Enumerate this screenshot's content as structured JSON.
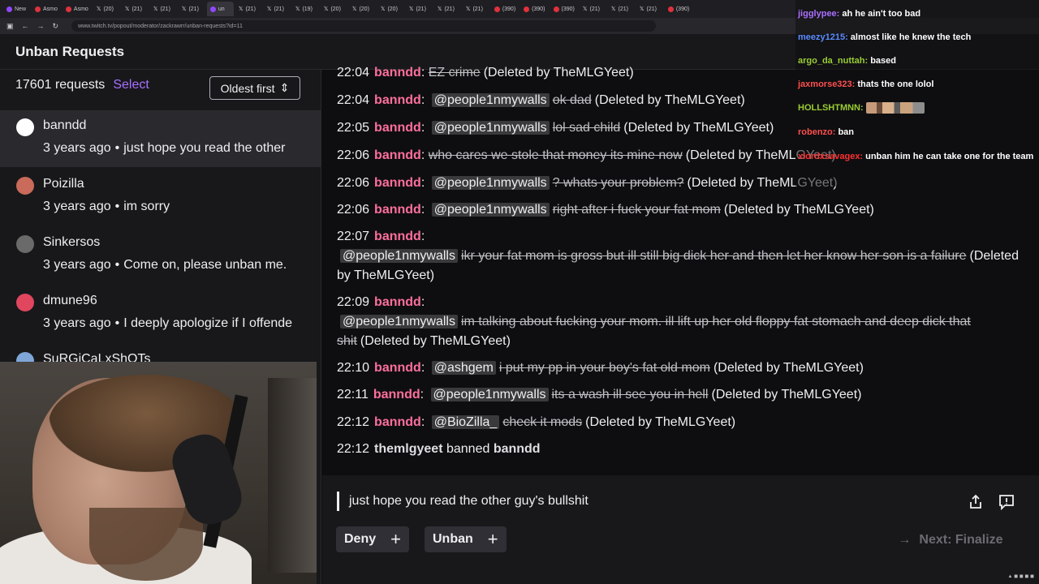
{
  "browser": {
    "tabs": [
      {
        "label": "New",
        "favicon": "twitch",
        "active": false
      },
      {
        "label": "Asmo",
        "favicon": "youtube",
        "active": false
      },
      {
        "label": "Asmo",
        "favicon": "youtube",
        "active": false
      },
      {
        "label": "(20)",
        "favicon": "x",
        "active": false
      },
      {
        "label": "(21)",
        "favicon": "x",
        "active": false
      },
      {
        "label": "(21)",
        "favicon": "x",
        "active": false
      },
      {
        "label": "(21)",
        "favicon": "x",
        "active": false
      },
      {
        "label": "un",
        "favicon": "twitch",
        "active": true
      },
      {
        "label": "(21)",
        "favicon": "x",
        "active": false
      },
      {
        "label": "(21)",
        "favicon": "x",
        "active": false
      },
      {
        "label": "(19)",
        "favicon": "x",
        "active": false
      },
      {
        "label": "(20)",
        "favicon": "x",
        "active": false
      },
      {
        "label": "(20)",
        "favicon": "x",
        "active": false
      },
      {
        "label": "(20)",
        "favicon": "x",
        "active": false
      },
      {
        "label": "(21)",
        "favicon": "x",
        "active": false
      },
      {
        "label": "(21)",
        "favicon": "x",
        "active": false
      },
      {
        "label": "(21)",
        "favicon": "x",
        "active": false
      },
      {
        "label": "(390)",
        "favicon": "youtube",
        "active": false
      },
      {
        "label": "(390)",
        "favicon": "youtube",
        "active": false
      },
      {
        "label": "(390)",
        "favicon": "youtube",
        "active": false
      },
      {
        "label": "(21)",
        "favicon": "x",
        "active": false
      },
      {
        "label": "(21)",
        "favicon": "x",
        "active": false
      },
      {
        "label": "(21)",
        "favicon": "x",
        "active": false
      },
      {
        "label": "(390)",
        "favicon": "youtube",
        "active": false
      }
    ],
    "url": "www.twitch.tv/popout/moderator/zackrawrr/unban-requests?id=11"
  },
  "page": {
    "title": "Unban Requests"
  },
  "list": {
    "count": "17601 requests",
    "select_label": "Select",
    "sort_label": "Oldest first",
    "items": [
      {
        "username": "banndd",
        "age": "3 years ago",
        "preview": "just hope you read the other",
        "avatar_color": "#ffffff",
        "selected": true
      },
      {
        "username": "Poizilla",
        "age": "3 years ago",
        "preview": "im sorry",
        "avatar_color": "#c96a5a",
        "selected": false
      },
      {
        "username": "Sinkersos",
        "age": "3 years ago",
        "preview": "Come on, please unban me.",
        "avatar_color": "#6a6a6a",
        "selected": false
      },
      {
        "username": "dmune96",
        "age": "3 years ago",
        "preview": "I deeply apologize if I offende",
        "avatar_color": "#e0465e",
        "selected": false
      },
      {
        "username": "SuRGiCaLxShOTs",
        "age": "",
        "preview": "",
        "avatar_color": "#7fa6d9",
        "selected": false
      }
    ]
  },
  "log": {
    "lines": [
      {
        "time": "22:04",
        "user": "banndd",
        "mention": "",
        "text": "EZ crime",
        "note": "(Deleted by TheMLGYeet)"
      },
      {
        "time": "22:04",
        "user": "banndd",
        "mention": "@people1nmywalls",
        "text": "ok dad",
        "note": "(Deleted by TheMLGYeet)"
      },
      {
        "time": "22:05",
        "user": "banndd",
        "mention": "@people1nmywalls",
        "text": "lol sad child",
        "note": "(Deleted by TheMLGYeet)"
      },
      {
        "time": "22:06",
        "user": "banndd",
        "mention": "",
        "text": "who cares we stole that money its mine now",
        "note": "(Deleted by TheMLGYeet)"
      },
      {
        "time": "22:06",
        "user": "banndd",
        "mention": "@people1nmywalls",
        "text": "? whats your problem?",
        "note": "(Deleted by TheMLGYeet)"
      },
      {
        "time": "22:06",
        "user": "banndd",
        "mention": "@people1nmywalls",
        "text": "right after i fuck your fat mom",
        "note": "(Deleted by TheMLGYeet)"
      },
      {
        "time": "22:07",
        "user": "banndd",
        "mention": "@people1nmywalls",
        "text": "ikr your fat mom is gross but ill still big dick her and then let her know her son is a failure",
        "note": "(Deleted by TheMLGYeet)"
      },
      {
        "time": "22:09",
        "user": "banndd",
        "mention": "@people1nmywalls",
        "text": "im talking about fucking your mom. ill lift up her old floppy fat stomach and deep dick that shit",
        "note": "(Deleted by TheMLGYeet)"
      },
      {
        "time": "22:10",
        "user": "banndd",
        "mention": "@ashgem",
        "text": "i put my pp in your boy's fat old mom",
        "note": "(Deleted by TheMLGYeet)"
      },
      {
        "time": "22:11",
        "user": "banndd",
        "mention": "@people1nmywalls",
        "text": "its a wash ill see you in hell",
        "note": "(Deleted by TheMLGYeet)"
      },
      {
        "time": "22:12",
        "user": "banndd",
        "mention": "@BioZilla_",
        "text": "check it mods",
        "note": "(Deleted by TheMLGYeet)"
      }
    ],
    "ban": {
      "time": "22:12",
      "moderator": "themlgyeet",
      "action": "banned",
      "target": "banndd"
    }
  },
  "request": {
    "text": "just hope you read the other guy's bullshit",
    "deny_label": "Deny",
    "unban_label": "Unban",
    "next_label": "Next: Finalize"
  },
  "overlay_chat": [
    {
      "name": "jigglypee:",
      "color": "#a970ff",
      "text": "ah he ain't too bad"
    },
    {
      "name": "meezy1215:",
      "color": "#5b8cff",
      "text": "almost like he knew the tech"
    },
    {
      "name": "argo_da_nuttah:",
      "color": "#9acd32",
      "text": "based"
    },
    {
      "name": "jaxmorse323:",
      "color": "#ff4f4f",
      "text": "thats the one lolol"
    },
    {
      "name": "HOLLSHTMNN:",
      "color": "#9acd32",
      "text": ""
    },
    {
      "name": "robenzo:",
      "color": "#ff4f4f",
      "text": "ban"
    },
    {
      "name": "xlordxsavagex:",
      "color": "#ff3030",
      "text": "unban him he can take one for the team"
    }
  ]
}
